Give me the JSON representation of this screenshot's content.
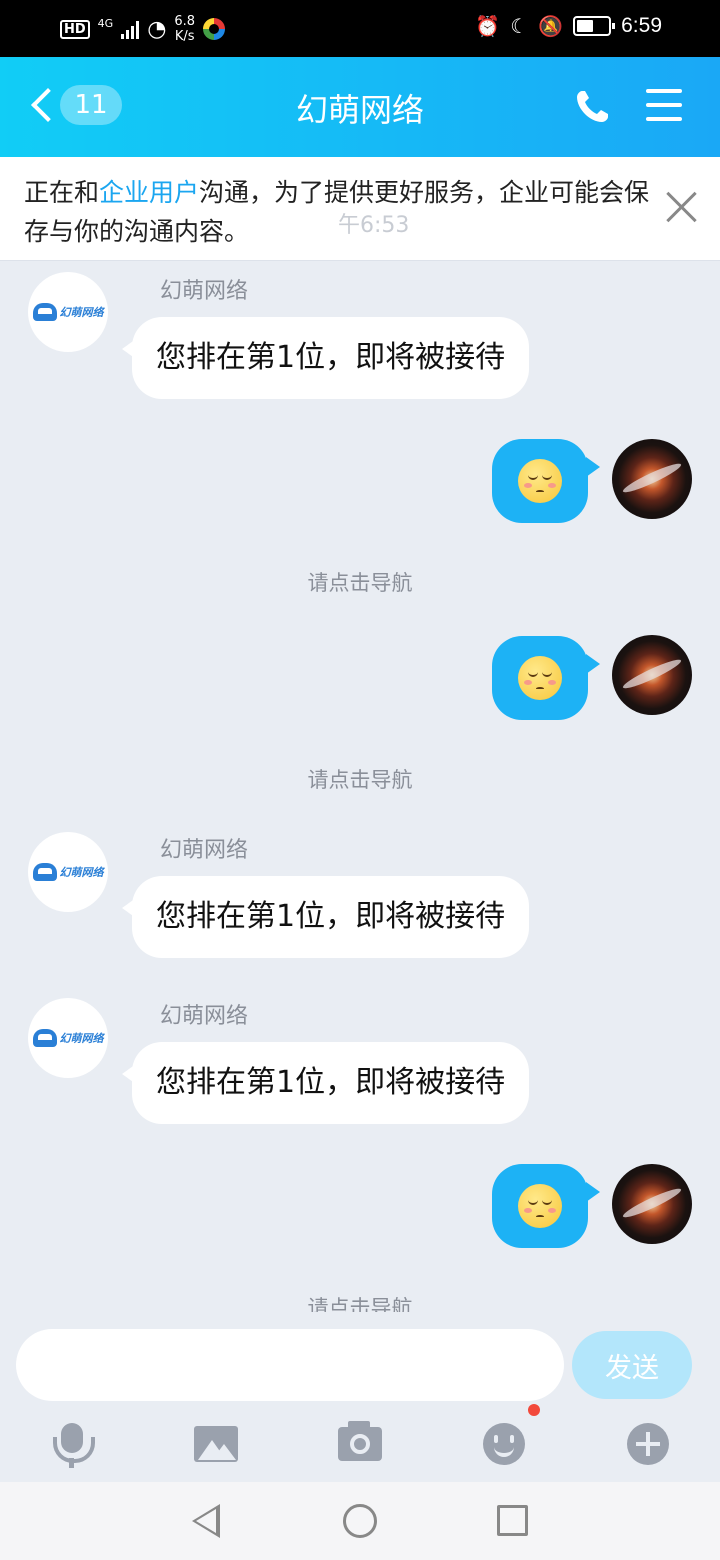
{
  "status_bar": {
    "hd": "HD",
    "network": "4G",
    "speed_value": "6.8",
    "speed_unit": "K/s",
    "time": "6:59"
  },
  "header": {
    "unread_count": "11",
    "title": "幻萌网络"
  },
  "notice": {
    "text_before": "正在和",
    "highlight": "企业用户",
    "text_after": "沟通，为了提供更好服务，企业可能会保存与你的沟通内容。",
    "faded_time": "午6:53"
  },
  "messages": [
    {
      "side": "left",
      "sender": "幻萌网络",
      "text": "您排在第1位，即将被接待",
      "logo_text": "幻萌网络"
    },
    {
      "side": "right",
      "content": "emoji-shy-face"
    },
    {
      "hint": "请点击导航"
    },
    {
      "side": "right",
      "content": "emoji-shy-face"
    },
    {
      "hint": "请点击导航"
    },
    {
      "side": "left",
      "sender": "幻萌网络",
      "text": "您排在第1位，即将被接待",
      "logo_text": "幻萌网络"
    },
    {
      "side": "left",
      "sender": "幻萌网络",
      "text": "您排在第1位，即将被接待",
      "logo_text": "幻萌网络"
    },
    {
      "side": "right",
      "content": "emoji-shy-face"
    },
    {
      "hint": "请点击导航"
    }
  ],
  "input": {
    "value": "",
    "send_label": "发送"
  },
  "toolbar": {
    "icons": [
      "microphone-icon",
      "image-icon",
      "camera-icon",
      "emoji-icon",
      "plus-icon"
    ]
  },
  "colors": {
    "header_start": "#11cdf6",
    "header_end": "#1aa8f6",
    "bubble_out": "#1db2f5",
    "highlight": "#1ba6f0",
    "background": "#e9edf3"
  }
}
